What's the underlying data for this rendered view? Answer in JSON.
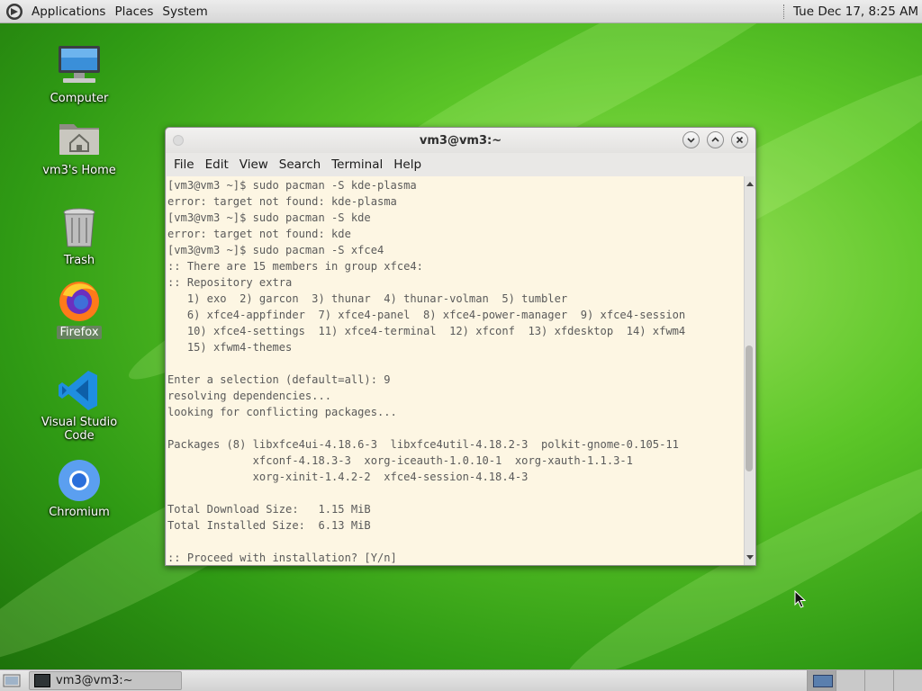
{
  "top_panel": {
    "menus": [
      "Applications",
      "Places",
      "System"
    ],
    "clock": "Tue Dec 17,  8:25 AM"
  },
  "desktop_icons": [
    {
      "label": "Computer",
      "icon": "computer-icon"
    },
    {
      "label": "vm3's Home",
      "icon": "home-folder-icon"
    },
    {
      "label": "Trash",
      "icon": "trash-icon"
    },
    {
      "label": "Firefox",
      "icon": "firefox-icon"
    },
    {
      "label": "Visual Studio Code",
      "icon": "vscode-icon"
    },
    {
      "label": "Chromium",
      "icon": "chromium-icon"
    }
  ],
  "terminal": {
    "title": "vm3@vm3:~",
    "menu": [
      "File",
      "Edit",
      "View",
      "Search",
      "Terminal",
      "Help"
    ],
    "lines": [
      "[vm3@vm3 ~]$ sudo pacman -S kde-plasma",
      "error: target not found: kde-plasma",
      "[vm3@vm3 ~]$ sudo pacman -S kde",
      "error: target not found: kde",
      "[vm3@vm3 ~]$ sudo pacman -S xfce4",
      ":: There are 15 members in group xfce4:",
      ":: Repository extra",
      "   1) exo  2) garcon  3) thunar  4) thunar-volman  5) tumbler",
      "   6) xfce4-appfinder  7) xfce4-panel  8) xfce4-power-manager  9) xfce4-session",
      "   10) xfce4-settings  11) xfce4-terminal  12) xfconf  13) xfdesktop  14) xfwm4",
      "   15) xfwm4-themes",
      "",
      "Enter a selection (default=all): 9",
      "resolving dependencies...",
      "looking for conflicting packages...",
      "",
      "Packages (8) libxfce4ui-4.18.6-3  libxfce4util-4.18.2-3  polkit-gnome-0.105-11",
      "             xfconf-4.18.3-3  xorg-iceauth-1.0.10-1  xorg-xauth-1.1.3-1",
      "             xorg-xinit-1.4.2-2  xfce4-session-4.18.4-3",
      "",
      "Total Download Size:   1.15 MiB",
      "Total Installed Size:  6.13 MiB",
      "",
      ":: Proceed with installation? [Y/n]"
    ],
    "scroll_fraction": 0.66
  },
  "bottom_panel": {
    "task_label": "vm3@vm3:~",
    "workspaces": 4,
    "active_workspace": 1
  },
  "colors": {
    "terminal_bg": "#fdf6e3",
    "terminal_fg": "#5a5a5a"
  }
}
